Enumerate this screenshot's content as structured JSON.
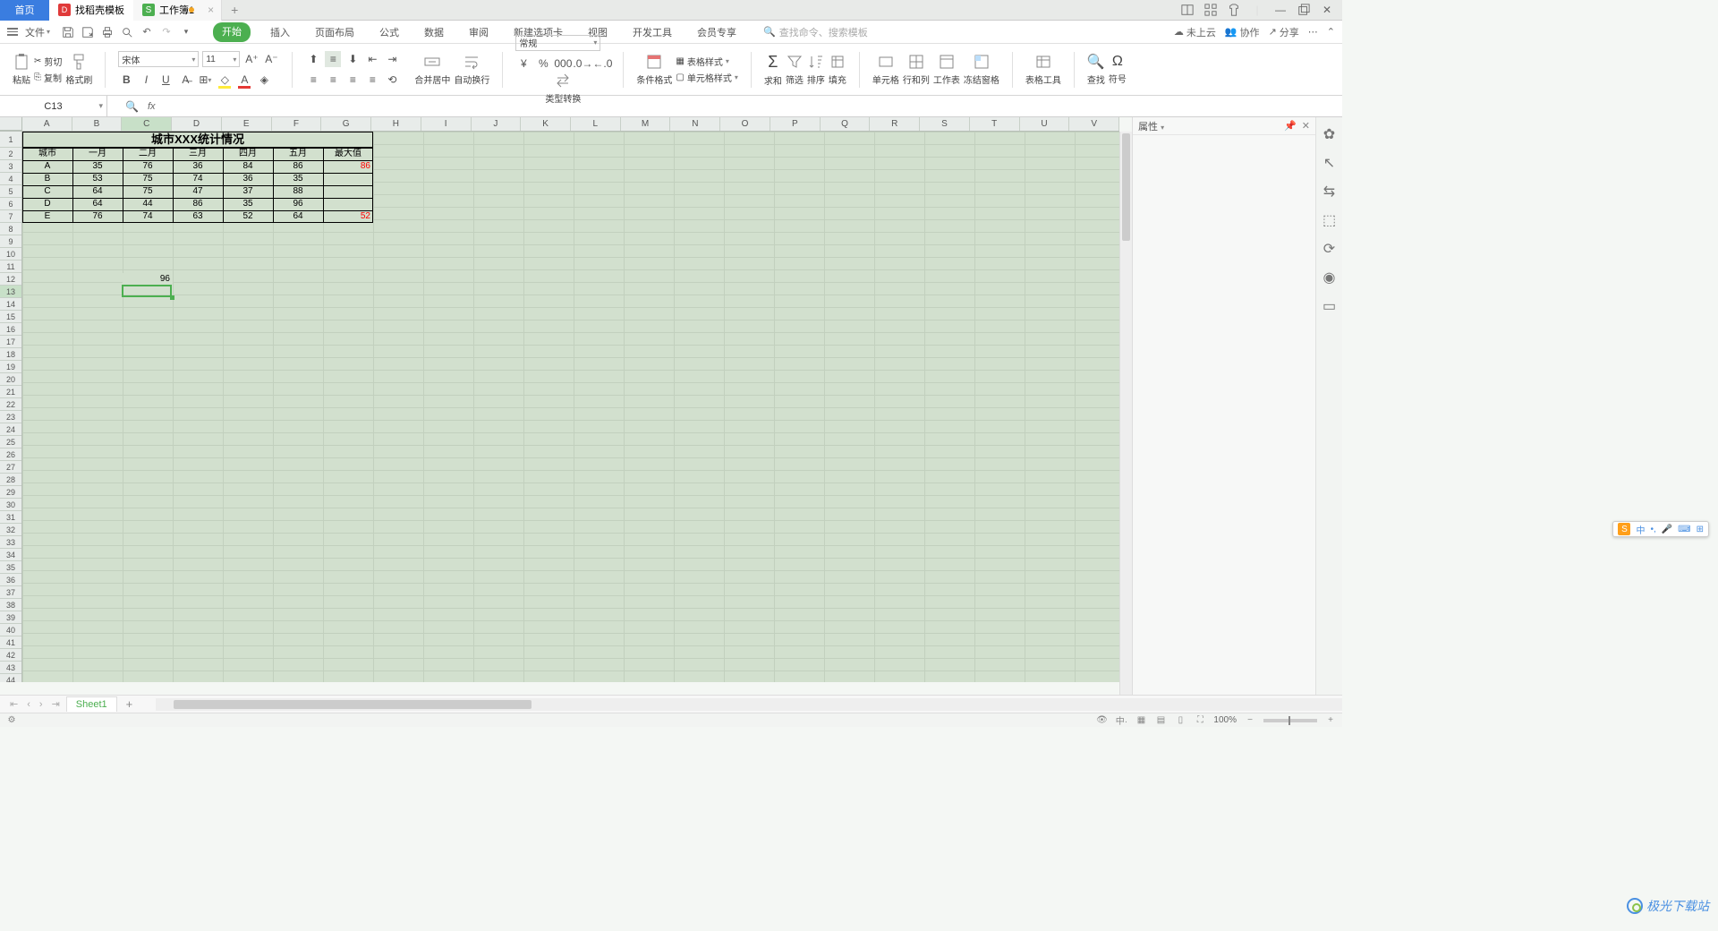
{
  "tabs": {
    "home": "首页",
    "template": "找稻壳模板",
    "doc": "工作簿1"
  },
  "menu": {
    "file": "文件",
    "items": [
      "开始",
      "插入",
      "页面布局",
      "公式",
      "数据",
      "审阅",
      "新建选项卡",
      "视图",
      "开发工具",
      "会员专享"
    ],
    "search_placeholder": "查找命令、搜索模板",
    "cloud": "未上云",
    "collab": "协作",
    "share": "分享"
  },
  "ribbon": {
    "paste": "粘贴",
    "cut": "剪切",
    "copy": "复制",
    "format_painter": "格式刷",
    "font_name": "宋体",
    "font_size": "11",
    "merge_center": "合并居中",
    "wrap": "自动换行",
    "num_format": "常规",
    "type_convert": "类型转换",
    "cond_fmt": "条件格式",
    "table_style": "表格样式",
    "cell_style": "单元格样式",
    "sum": "求和",
    "filter": "筛选",
    "sort": "排序",
    "fill": "填充",
    "cell": "单元格",
    "rowcol": "行和列",
    "worksheet": "工作表",
    "freeze": "冻结窗格",
    "table_tools": "表格工具",
    "find": "查找",
    "symbol": "符号"
  },
  "namebox": "C13",
  "props_title": "属性",
  "columns": [
    "A",
    "B",
    "C",
    "D",
    "E",
    "F",
    "G",
    "H",
    "I",
    "J",
    "K",
    "L",
    "M",
    "N",
    "O",
    "P",
    "Q",
    "R",
    "S",
    "T",
    "U",
    "V"
  ],
  "table": {
    "title": "城市XXX统计情况",
    "headers": [
      "城市",
      "一月",
      "二月",
      "三月",
      "四月",
      "五月",
      "最大值"
    ],
    "rows": [
      [
        "A",
        "35",
        "76",
        "36",
        "84",
        "86",
        "86"
      ],
      [
        "B",
        "53",
        "75",
        "74",
        "36",
        "35",
        ""
      ],
      [
        "C",
        "64",
        "75",
        "47",
        "37",
        "88",
        ""
      ],
      [
        "D",
        "64",
        "44",
        "86",
        "35",
        "96",
        ""
      ],
      [
        "E",
        "76",
        "74",
        "63",
        "52",
        "64",
        "52"
      ]
    ],
    "max_color": "#ff0000"
  },
  "floating_cell": {
    "row": 12,
    "col": 2,
    "value": "96"
  },
  "active_cell": {
    "row": 13,
    "col": 2
  },
  "sheet_tab": "Sheet1",
  "zoom": "100%",
  "watermark": "极光下载站",
  "ime_lang": "中"
}
